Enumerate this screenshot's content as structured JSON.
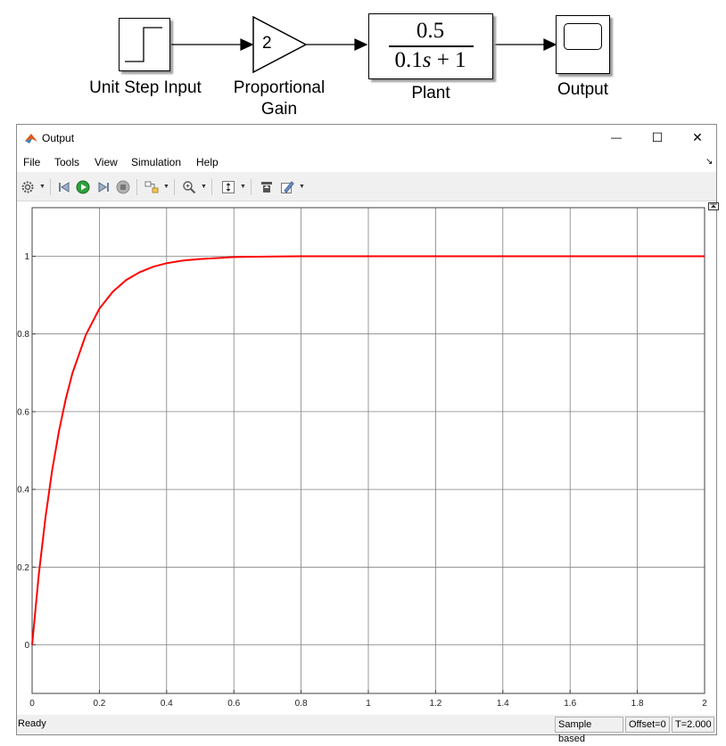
{
  "diagram": {
    "blocks": [
      {
        "id": "step",
        "label": "Unit Step Input"
      },
      {
        "id": "gain",
        "label_line1": "Proportional",
        "label_line2": "Gain",
        "value": "2"
      },
      {
        "id": "plant",
        "label": "Plant",
        "numerator": "0.5",
        "denominator": "0.1s + 1",
        "den_coeff": "0.1",
        "den_var": "s",
        "den_rest": " + 1"
      },
      {
        "id": "scope",
        "label": "Output"
      }
    ]
  },
  "window": {
    "title": "Output",
    "controls": {
      "minimize": "—",
      "maximize": "☐",
      "close": "✕"
    },
    "menu": [
      "File",
      "Tools",
      "View",
      "Simulation",
      "Help"
    ],
    "undock_icon": "↘",
    "toolbar_icons": [
      "gear-icon",
      "step-back-icon",
      "run-icon",
      "step-forward-icon",
      "stop-icon",
      "highlight-block-icon",
      "zoom-icon",
      "autoscale-icon",
      "restore-icon",
      "style-icon"
    ]
  },
  "status": {
    "left": "Ready",
    "sample": "Sample based",
    "offset": "Offset=0",
    "time": "T=2.000"
  },
  "colors": {
    "line": "#ff0000",
    "grid": "#808080",
    "axes_bg": "#ffffff"
  },
  "chart_data": {
    "type": "line",
    "title": "",
    "xlabel": "",
    "ylabel": "",
    "xlim": [
      0,
      2
    ],
    "ylim": [
      -0.125,
      1.125
    ],
    "xticks": [
      0,
      0.2,
      0.4,
      0.6,
      0.8,
      1,
      1.2,
      1.4,
      1.6,
      1.8,
      2
    ],
    "xtick_labels": [
      "0",
      "0.2",
      "0.4",
      "0.6",
      "0.8",
      "1",
      "1.2",
      "1.4",
      "1.6",
      "1.8",
      "2"
    ],
    "yticks": [
      0,
      0.2,
      0.4,
      0.6,
      0.8,
      1
    ],
    "ytick_labels": [
      "0",
      "0.2",
      "0.4",
      "0.6",
      "0.8",
      "1"
    ],
    "grid": true,
    "legend": "none",
    "series": [
      {
        "name": "Output",
        "x": [
          0,
          0.02,
          0.04,
          0.06,
          0.08,
          0.1,
          0.12,
          0.16,
          0.2,
          0.24,
          0.28,
          0.32,
          0.36,
          0.4,
          0.45,
          0.5,
          0.6,
          0.7,
          0.8,
          1.0,
          1.2,
          1.4,
          1.6,
          1.8,
          2.0
        ],
        "y": [
          0,
          0.181,
          0.33,
          0.451,
          0.551,
          0.632,
          0.699,
          0.798,
          0.865,
          0.909,
          0.939,
          0.959,
          0.973,
          0.982,
          0.989,
          0.993,
          0.998,
          0.999,
          1.0,
          1.0,
          1.0,
          1.0,
          1.0,
          1.0,
          1.0
        ]
      }
    ]
  }
}
